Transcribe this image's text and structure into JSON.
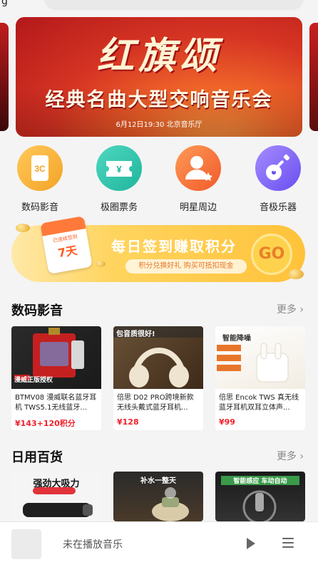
{
  "banner": {
    "title": "红旗颂",
    "subtitle": "经典名曲大型交响音乐会",
    "date_venue": "6月12日19:30  北京音乐厅"
  },
  "categories": [
    {
      "label": "数码影音",
      "icon": "3c-device-icon",
      "glyph": "3C",
      "color": "#f3a326"
    },
    {
      "label": "极圈票务",
      "icon": "ticket-icon",
      "glyph": "¥",
      "color": "#20b59c"
    },
    {
      "label": "明星周边",
      "icon": "star-person-icon",
      "glyph": "",
      "color": "#f05a2a"
    },
    {
      "label": "音极乐器",
      "icon": "guitar-icon",
      "glyph": "",
      "color": "#6a4ef0"
    }
  ],
  "signin": {
    "title": "每日签到赚取积分",
    "subtitle": "积分兑换好礼 购买可抵扣现金",
    "go": "GO",
    "calendar_text": "已连续签到",
    "calendar_num": "7天"
  },
  "section1": {
    "title": "数码影音",
    "more": "更多",
    "products": [
      {
        "name": "BTMV08 漫威联名蓝牙耳机 TWS5.1无线蓝牙...",
        "price": "¥143+120积分",
        "badge": "漫威正版授权"
      },
      {
        "name": "倍思 D02 PRO跨境新款无线头戴式蓝牙耳机...",
        "price": "¥128",
        "badge": "包音质很好!"
      },
      {
        "name": "倍思 Encok TWS 真无线蓝牙耳机双耳立体声...",
        "price": "¥99",
        "badge": "智能降噪"
      }
    ]
  },
  "section2": {
    "title": "日用百货",
    "more": "更多",
    "products": [
      {
        "badge": "强劲大吸力"
      },
      {
        "badge": "补水一整天"
      },
      {
        "badge": "智能感应 车动自动"
      }
    ]
  },
  "player": {
    "status": "未在播放音乐"
  },
  "colors": {
    "price": "#f0222c",
    "accent_orange": "#ffc23a"
  }
}
